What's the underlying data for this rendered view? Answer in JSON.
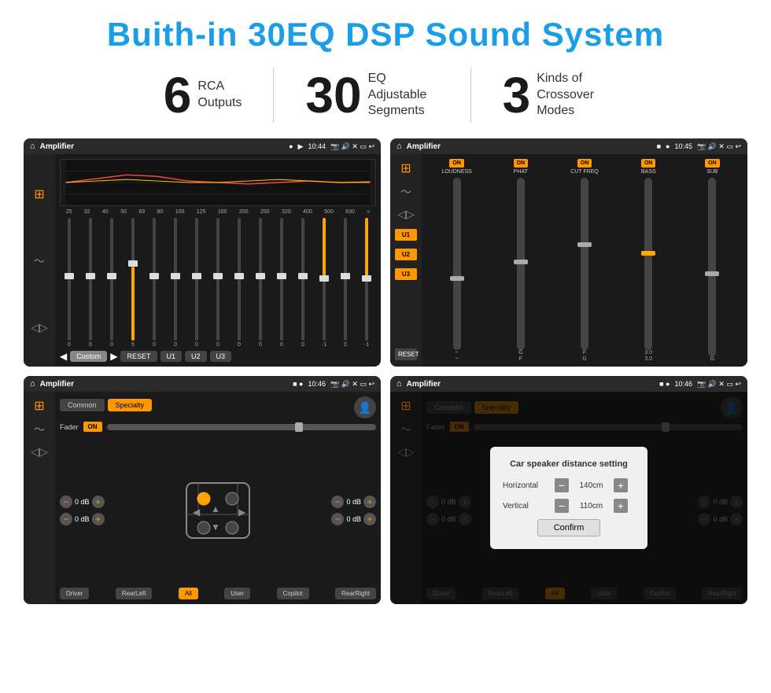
{
  "title": "Buith-in 30EQ DSP Sound System",
  "stats": [
    {
      "number": "6",
      "label": "RCA\nOutputs"
    },
    {
      "number": "30",
      "label": "EQ Adjustable\nSegments"
    },
    {
      "number": "3",
      "label": "Kinds of\nCrossover Modes"
    }
  ],
  "screens": [
    {
      "id": "screen1",
      "statusBar": {
        "time": "10:44",
        "title": "Amplifier"
      },
      "type": "eq"
    },
    {
      "id": "screen2",
      "statusBar": {
        "time": "10:45",
        "title": "Amplifier"
      },
      "type": "mixer"
    },
    {
      "id": "screen3",
      "statusBar": {
        "time": "10:46",
        "title": "Amplifier"
      },
      "type": "speaker"
    },
    {
      "id": "screen4",
      "statusBar": {
        "time": "10:46",
        "title": "Amplifier"
      },
      "type": "distance"
    }
  ],
  "eq": {
    "freqs": [
      "25",
      "32",
      "40",
      "50",
      "63",
      "80",
      "100",
      "125",
      "160",
      "200",
      "250",
      "320",
      "400",
      "500",
      "630"
    ],
    "values": [
      "0",
      "0",
      "0",
      "5",
      "0",
      "0",
      "0",
      "0",
      "0",
      "0",
      "0",
      "0",
      "-1",
      "0",
      "-1"
    ],
    "buttons": [
      "Custom",
      "RESET",
      "U1",
      "U2",
      "U3"
    ]
  },
  "mixer": {
    "presets": [
      "U1",
      "U2",
      "U3"
    ],
    "channels": [
      {
        "label": "LOUDNESS",
        "on": true
      },
      {
        "label": "PHAT",
        "on": true
      },
      {
        "label": "CUT FREQ",
        "on": true
      },
      {
        "label": "BASS",
        "on": true
      },
      {
        "label": "SUB",
        "on": true
      }
    ],
    "reset": "RESET"
  },
  "speaker": {
    "tabs": [
      "Common",
      "Specialty"
    ],
    "fader": {
      "label": "Fader",
      "on": true
    },
    "volumes": [
      {
        "value": "0 dB"
      },
      {
        "value": "0 dB"
      },
      {
        "value": "0 dB"
      },
      {
        "value": "0 dB"
      }
    ],
    "bottomBtns": [
      "Driver",
      "RearLeft",
      "All",
      "User",
      "Copilot",
      "RearRight"
    ]
  },
  "distance": {
    "tabs": [
      "Common",
      "Specialty"
    ],
    "dialog": {
      "title": "Car speaker distance setting",
      "horizontal": {
        "label": "Horizontal",
        "value": "140cm"
      },
      "vertical": {
        "label": "Vertical",
        "value": "110cm"
      },
      "confirm": "Confirm"
    },
    "bottomBtns": [
      "Driver",
      "RearLeft",
      "All",
      "User",
      "Copilot",
      "RearRight"
    ]
  }
}
